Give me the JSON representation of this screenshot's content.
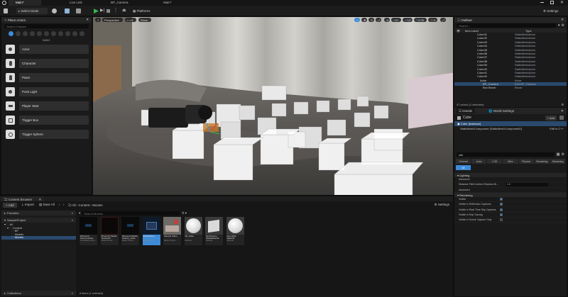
{
  "titlebar": {
    "tabs": [
      "Main*",
      "Live Link",
      "BP_Camera",
      "Main*"
    ]
  },
  "toolbar": {
    "mode": "Select Mode",
    "platforms": "Platforms",
    "settings": "Settings"
  },
  "place_actors": {
    "title": "Place Actors",
    "search_placeholder": "Search Classes",
    "section": "BASIC",
    "items": [
      "Actor",
      "Character",
      "Pawn",
      "Point Light",
      "Player Start",
      "Trigger Box",
      "Trigger Sphere"
    ]
  },
  "viewport": {
    "perspective": "Perspective",
    "lit": "Lit",
    "show": "Show",
    "grid_value": "10",
    "angle_value": "10°",
    "scale_value": "0.25",
    "camera_speed": "4"
  },
  "outliner": {
    "title": "Outliner",
    "search_placeholder": "Search...",
    "col_label": "Item Label",
    "col_type": "Type",
    "rows": [
      {
        "name": "Cube31",
        "type": "StaticMeshActor"
      },
      {
        "name": "Cube32",
        "type": "StaticMeshActor"
      },
      {
        "name": "Cube33",
        "type": "StaticMeshActor"
      },
      {
        "name": "Cube34",
        "type": "StaticMeshActor"
      },
      {
        "name": "Cube35",
        "type": "StaticMeshActor"
      },
      {
        "name": "Cube36",
        "type": "StaticMeshActor"
      },
      {
        "name": "Cube37",
        "type": "StaticMeshActor"
      },
      {
        "name": "Cube38",
        "type": "StaticMeshActor"
      },
      {
        "name": "Cube39",
        "type": "StaticMeshActor"
      },
      {
        "name": "Cube40",
        "type": "StaticMeshActor"
      },
      {
        "name": "Cube41",
        "type": "StaticMeshActor"
      },
      {
        "name": "Cube42",
        "type": "StaticMeshActor"
      },
      {
        "name": "Actor",
        "type": "Actor"
      },
      {
        "name": "BP_Camera",
        "type": "Edit BP_Camera"
      },
      {
        "name": "Box Brush",
        "type": "Brush"
      }
    ],
    "footer": "47 actors (1 selected)"
  },
  "details": {
    "tab1": "Details",
    "tab2": "World Settings",
    "object": "Cube",
    "add_label": "+ Add",
    "instance": "Cube (Instance)",
    "component": "StaticMeshComponent (StaticMeshComponent0)",
    "edit_cpp": "Edit in C++",
    "search_value": "visi",
    "categories_row1": [
      "General",
      "Actor",
      "LOD",
      "Misc",
      "Physics",
      "Rendering",
      "Streaming"
    ],
    "categories_row2": [
      "All"
    ],
    "sections": {
      "lighting": "Lighting",
      "advanced1": "Advanced",
      "distance_field": "Distance Field Indirect Shadow Mi...",
      "distance_value": "1.0",
      "advanced2": "Advanced",
      "rendering": "Rendering",
      "visible": "Visible",
      "visible_reflection": "Visible in Reflection Captures",
      "visible_realtime": "Visible in Real Time Sky Captures",
      "visible_raytracing": "Visible in Ray Tracing",
      "visible_scene_capture": "Visible in Scene Capture Only"
    }
  },
  "content_browser": {
    "tab": "Content Browser",
    "add_label": "+ Add",
    "import_label": "Import",
    "save_all_label": "Save All",
    "breadcrumb": [
      "All",
      "Content",
      "Movies"
    ],
    "settings_label": "Settings",
    "search_placeholder": "Search Movies",
    "favorites": "Favorites",
    "project": "SampleProject",
    "tree": [
      "All",
      "Content",
      "BP",
      "Models",
      "Movies"
    ],
    "collections": "Collections",
    "status": "8 items (1 selected)",
    "assets": [
      {
        "name": "iPhone14 Source Movie",
        "type": "File Media Source",
        "thumb": "dark"
      },
      {
        "name": "iPhone14 Media Texture22",
        "type": "Media Texture",
        "thumb": "red"
      },
      {
        "name": "iPhone14 Media Texture_Cube",
        "type": "Media Texture",
        "thumb": "dark"
      },
      {
        "name": "MediaPlayer",
        "type": "Media Player",
        "thumb": "video"
      },
      {
        "name": "Sample Video",
        "type": "Media Texture",
        "thumb": "photo"
      },
      {
        "name": "MI_Video",
        "type": "Material",
        "thumb": "sphere"
      },
      {
        "name": "NewTexture GlassMaterial",
        "type": "Material",
        "thumb": "cube"
      },
      {
        "name": "RoomMat Material",
        "type": "Material",
        "thumb": "sphere"
      }
    ]
  },
  "colors": {
    "accent": "#3d8bd6",
    "play": "#3ab74a",
    "selected_row": "#2a4a6e"
  }
}
